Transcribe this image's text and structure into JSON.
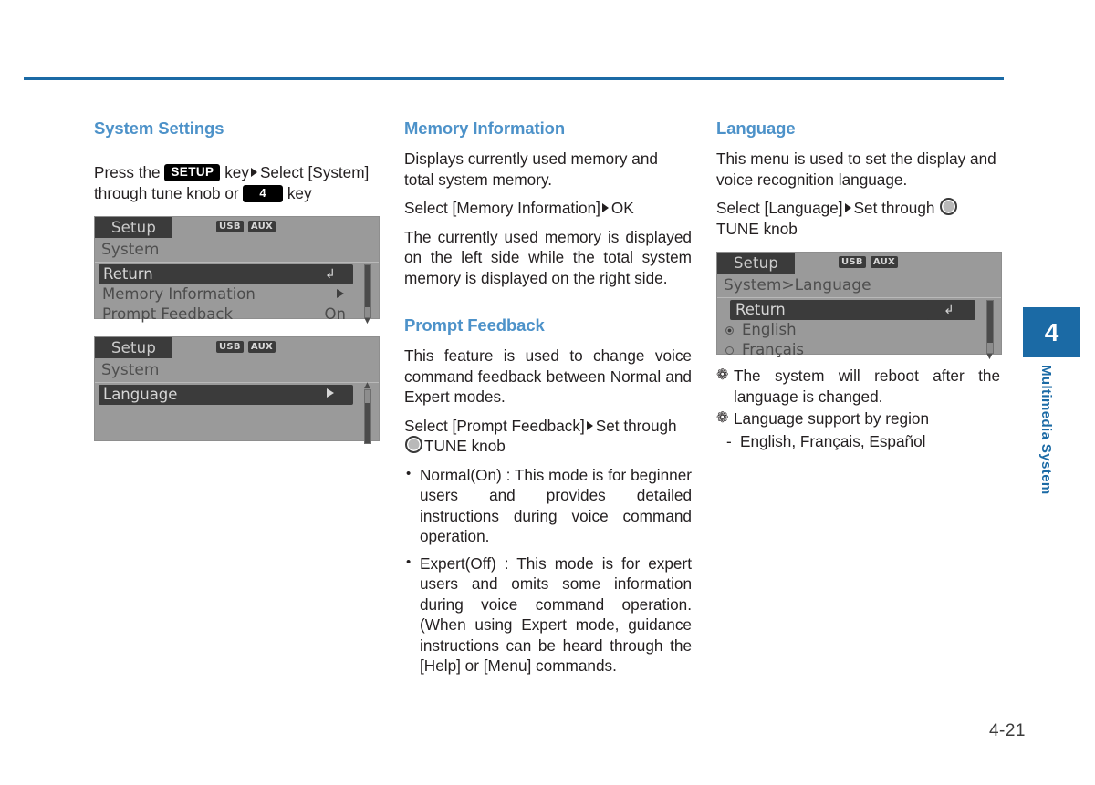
{
  "page": {
    "number": "4-21",
    "chapter_number": "4",
    "chapter_label": "Multimedia System"
  },
  "column1": {
    "heading": "System Settings",
    "intro": {
      "pre": "Press the",
      "key_badge": "SETUP",
      "mid": "key",
      "after_arrow": "Select [System] through tune knob or",
      "num_badge": "4",
      "post": "key"
    },
    "screen_1": {
      "tab": "Setup",
      "badges": [
        "USB",
        "AUX"
      ],
      "title": "System",
      "rows": [
        {
          "label": "Return",
          "value": "",
          "selected": true,
          "action": "return-icon"
        },
        {
          "label": "Memory Information",
          "value": "",
          "selected": false,
          "action": "arrow"
        },
        {
          "label": "Prompt Feedback",
          "value": "On",
          "selected": false,
          "action": ""
        }
      ]
    },
    "screen_2": {
      "tab": "Setup",
      "badges": [
        "USB",
        "AUX"
      ],
      "title": "System",
      "rows": [
        {
          "label": "Language",
          "value": "",
          "selected": true,
          "action": "arrow"
        }
      ]
    }
  },
  "column2": {
    "memory": {
      "heading": "Memory Information",
      "p1": "Displays currently used memory and total system memory.",
      "p2_pre": "Select [Memory Information]",
      "p2_post": "OK",
      "p3": "The currently used memory is displayed on the left side while the total system memory is displayed on the right side."
    },
    "prompt": {
      "heading": "Prompt Feedback",
      "p1": "This feature is used to change voice command feedback between Normal and Expert modes.",
      "p2_pre": "Select     [Prompt     Feedback]",
      "p2_mid": "Set through",
      "p2_post": "TUNE knob",
      "bullets": [
        "Normal(On)  :  This  mode  is  for beginner   users   and   provides detailed  instructions  during  voice command operation.",
        "Expert(Off) : This mode is for expert users  and  omits  some  information during  voice  command  operation. (When  using  Expert  mode,  guidance   instructions   can   be   heard through the [Help] or [Menu] commands."
      ]
    }
  },
  "column3": {
    "language": {
      "heading": "Language",
      "p1": "This menu is used to set the display and voice recognition language.",
      "p2_pre": "Select [Language]",
      "p2_mid": "Set through",
      "p2_post": "TUNE knob"
    },
    "screen_3": {
      "tab": "Setup",
      "badges": [
        "USB",
        "AUX"
      ],
      "title": "System>Language",
      "rows": [
        {
          "label": "Return",
          "value": "",
          "selected": true,
          "action": "return-icon",
          "radio": null
        },
        {
          "label": "English",
          "value": "",
          "selected": false,
          "action": "",
          "radio": "on"
        },
        {
          "label": "Français",
          "value": "",
          "selected": false,
          "action": "",
          "radio": "off"
        }
      ]
    },
    "notes": [
      "The system will reboot after the language is changed.",
      "Language support by region"
    ],
    "sub_note": "English, Français, Español"
  }
}
